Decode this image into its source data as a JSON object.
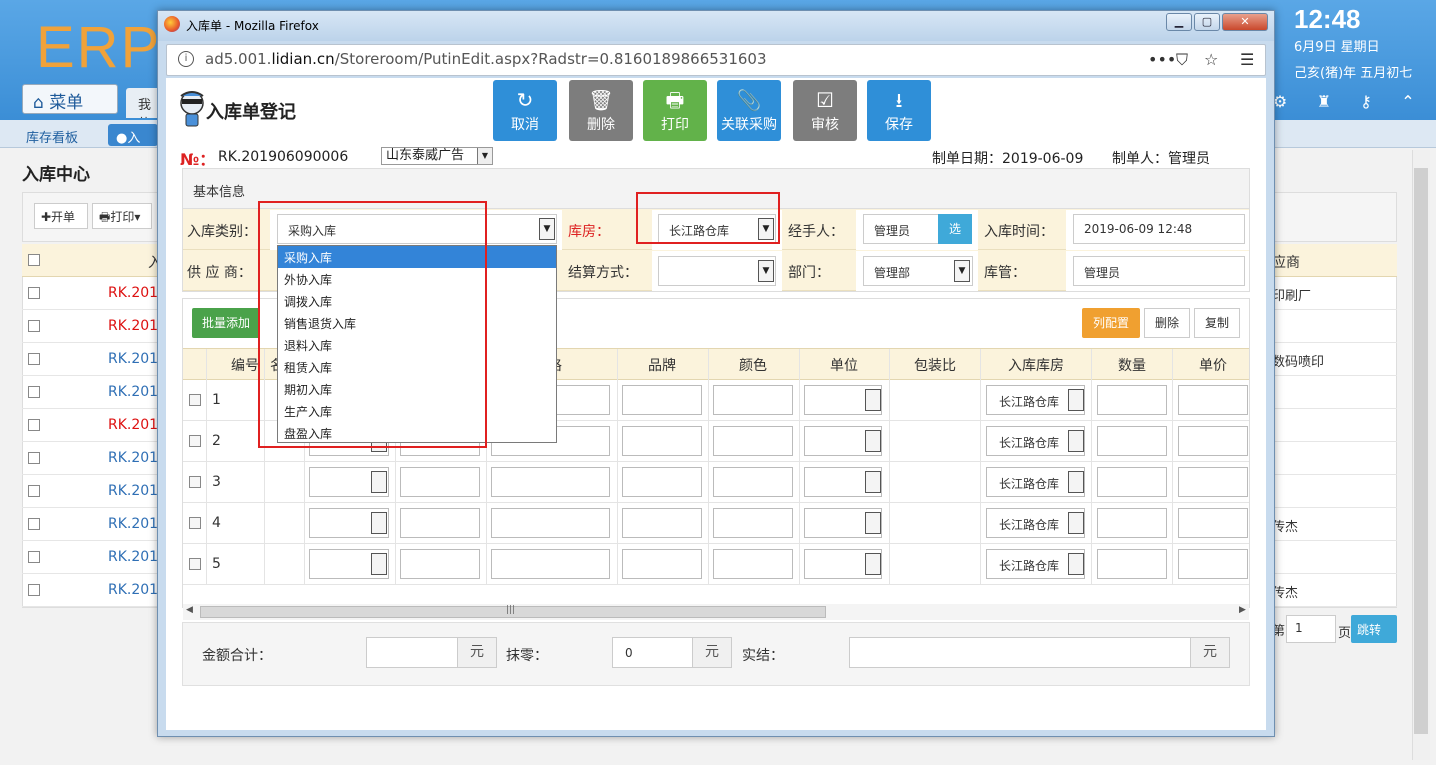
{
  "bg_app": {
    "logo": "ERP",
    "menu_button": "菜单",
    "my_tab": "我的",
    "clock": "12:48",
    "date_line1": "6月9日 星期日",
    "date_line2": "己亥(猪)年 五月初七",
    "nav_tabs": [
      "库存看板",
      "●入库"
    ],
    "page_title": "入库中心",
    "toolbar": {
      "open": "✚开单",
      "print": "🖶打印▾"
    },
    "table_header_first": "入",
    "table_header_supplier": "应商",
    "rows": [
      {
        "code": "RK.201",
        "color": "red",
        "supplier": "印刷厂"
      },
      {
        "code": "RK.201",
        "color": "red",
        "supplier": ""
      },
      {
        "code": "RK.201",
        "color": "blue",
        "supplier": "数码喷印"
      },
      {
        "code": "RK.201",
        "color": "blue",
        "supplier": ""
      },
      {
        "code": "RK.201",
        "color": "red",
        "supplier": ""
      },
      {
        "code": "RK.201",
        "color": "blue",
        "supplier": ""
      },
      {
        "code": "RK.201",
        "color": "blue",
        "supplier": ""
      },
      {
        "code": "RK.201",
        "color": "blue",
        "supplier": "传杰"
      },
      {
        "code": "RK.201",
        "color": "blue",
        "supplier": ""
      },
      {
        "code": "RK.201",
        "color": "blue",
        "supplier": "传杰"
      }
    ],
    "pager": {
      "prefix": "第",
      "page": "1",
      "suffix": "页",
      "jump": "跳转"
    }
  },
  "browser": {
    "window_title": "入库单 - Mozilla Firefox",
    "url_prefix": "ad5.001.",
    "url_domain": "lidian.cn",
    "url_path": "/Storeroom/PutinEdit.aspx?Radstr=0.8160189866531603",
    "url_actions": [
      "•••",
      "⛉",
      "☆"
    ],
    "menu_icon": "☰"
  },
  "form": {
    "title": "入库单登记",
    "buttons": [
      {
        "id": "cancel",
        "icon": "↻",
        "label": "取消"
      },
      {
        "id": "delete",
        "icon": "🗑",
        "label": "删除"
      },
      {
        "id": "print",
        "icon": "🖶",
        "label": "打印"
      },
      {
        "id": "link",
        "icon": "📎",
        "label": "关联采购"
      },
      {
        "id": "audit",
        "icon": "☑",
        "label": "审核"
      },
      {
        "id": "save",
        "icon": "⭳",
        "label": "保存"
      }
    ],
    "no_label": "№：",
    "no_value": "RK.201906090006",
    "supplier_company": "山东泰威广告",
    "make_date": "制单日期：2019-06-09",
    "maker": "制单人：管理员",
    "basic_title": "基本信息",
    "fields": {
      "type_label": "入库类别：",
      "type_value": "采购入库",
      "warehouse_label": "库房：",
      "warehouse_value": "长江路仓库",
      "handler_label": "经手人：",
      "handler_value": "管理员",
      "pick": "选",
      "time_label": "入库时间：",
      "time_value": "2019-06-09 12:48",
      "supplier_label": "供 应 商：",
      "settle_label": "结算方式：",
      "settle_value": "",
      "dept_label": "部门：",
      "dept_value": "管理部",
      "keeper_label": "库管：",
      "keeper_value": "管理员"
    },
    "type_options": [
      "采购入库",
      "外协入库",
      "调拨入库",
      "销售退货入库",
      "退料入库",
      "租赁入库",
      "期初入库",
      "生产入库",
      "盘盈入库"
    ],
    "detail": {
      "batch_add": "批量添加",
      "col_config": "列配置",
      "delete": "删除",
      "copy": "复制",
      "headers": [
        "编号",
        "名",
        "格",
        "品牌",
        "颜色",
        "单位",
        "包装比",
        "入库库房",
        "数量",
        "单价"
      ],
      "rows": [
        {
          "no": "1",
          "warehouse": "长江路仓库"
        },
        {
          "no": "2",
          "warehouse": "长江路仓库"
        },
        {
          "no": "3",
          "warehouse": "长江路仓库"
        },
        {
          "no": "4",
          "warehouse": "长江路仓库"
        },
        {
          "no": "5",
          "warehouse": "长江路仓库"
        }
      ]
    },
    "summary": {
      "total_label": "金额合计：",
      "total_value": "",
      "unit": "元",
      "round_label": "抹零：",
      "round_value": "0",
      "actual_label": "实结：",
      "actual_value": ""
    }
  }
}
